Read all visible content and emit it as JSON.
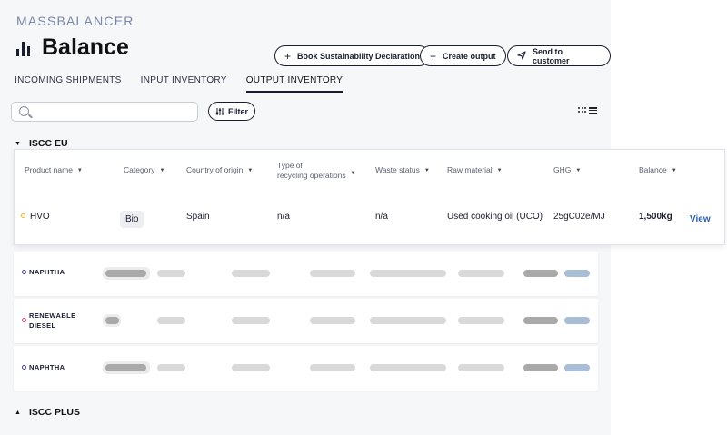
{
  "brand": "MASSBALANCER",
  "page_title": "Balance",
  "actions": [
    {
      "label": "Book Sustainability Declaration",
      "icon": "plus-icon"
    },
    {
      "label": "Create output",
      "icon": "plus-icon"
    },
    {
      "label": "Send to customer",
      "icon": "send-icon"
    }
  ],
  "tabs": [
    "INCOMING SHIPMENTS",
    "INPUT INVENTORY",
    "OUTPUT INVENTORY"
  ],
  "active_tab": "OUTPUT INVENTORY",
  "search": {
    "placeholder": "",
    "value": ""
  },
  "filter_label": "Filter",
  "groups": [
    {
      "name": "ISCC EU",
      "expanded": true
    },
    {
      "name": "ISCC PLUS",
      "expanded": false
    }
  ],
  "columns": [
    "Product name",
    "Category",
    "Country of origin",
    "Type of\nrecycling operations",
    "Waste status",
    "Raw material",
    "GHG",
    "Balance"
  ],
  "expanded_row": {
    "product": "HVO",
    "category": "Bio",
    "country": "Spain",
    "recycling": "n/a",
    "waste_status": "n/a",
    "raw_material": "Used cooking oil (UCO)",
    "ghg": "25gC02e/MJ",
    "balance": "1,500kg",
    "action": "View",
    "status_color": "#e6b521"
  },
  "loading_rows": [
    {
      "name": "NAPHTHA",
      "dot_color": "#3a3d9e"
    },
    {
      "name": "RENEWABLE\nDIESEL",
      "dot_color": "#d9456a"
    },
    {
      "name": "NAPHTHA",
      "dot_color": "#3a3d9e"
    }
  ]
}
